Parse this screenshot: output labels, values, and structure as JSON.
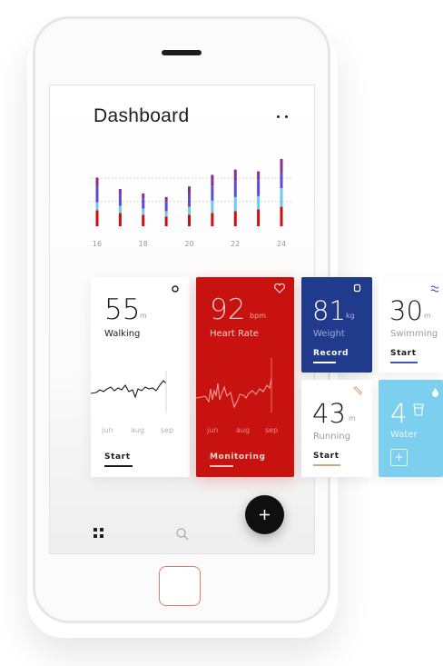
{
  "screen": {
    "title": "Dashboard",
    "menu_icon": "more-dots-icon"
  },
  "chart_data": {
    "type": "bar",
    "stacked": true,
    "x": [
      16,
      17,
      18,
      19,
      20,
      21,
      22,
      23,
      24
    ],
    "tick_labels": [
      "16",
      "18",
      "20",
      "22",
      "24"
    ],
    "series": [
      {
        "color": "#c8120f",
        "values": [
          18,
          15,
          13,
          11,
          13,
          15,
          17,
          19,
          22
        ]
      },
      {
        "color": "#6fc6ef",
        "values": [
          9,
          8,
          7,
          6,
          9,
          14,
          16,
          15,
          21
        ]
      },
      {
        "color": "#5b4bd6",
        "values": [
          18,
          14,
          11,
          10,
          14,
          17,
          18,
          18,
          18
        ]
      },
      {
        "color": "#8a2f8f",
        "values": [
          10,
          5,
          6,
          6,
          9,
          12,
          13,
          10,
          15
        ]
      }
    ],
    "ylim": [
      0,
      80
    ],
    "grid": true
  },
  "cards": {
    "walking": {
      "value": "55",
      "unit": "m",
      "label": "Walking",
      "action": "Start",
      "months": [
        "jun",
        "aug",
        "sep"
      ],
      "icon": "circle-icon"
    },
    "heart_rate": {
      "value": "92",
      "unit": "bpm",
      "label": "Heart Rate",
      "action": "Monitoring",
      "months": [
        "jun",
        "aug",
        "sep"
      ],
      "icon": "heart-icon"
    },
    "weight": {
      "value": "81",
      "unit": "kg",
      "label": "Weight",
      "action": "Record",
      "icon": "scale-icon"
    },
    "swimming": {
      "value": "30",
      "unit": "m",
      "label": "Swimming",
      "action": "Start",
      "icon": "waves-icon"
    },
    "running": {
      "value": "43",
      "unit": "m",
      "label": "Running",
      "action": "Start",
      "icon": "shoe-icon"
    },
    "water": {
      "value": "4",
      "label": "Water",
      "action": "+",
      "icon": "glass-icon"
    }
  },
  "nav": {
    "items": [
      "grid-icon",
      "search-icon"
    ],
    "fab": "+"
  },
  "colors": {
    "heart": "#c8120f",
    "weight": "#213b8c",
    "water": "#7dcff0",
    "swimming_accent": "#3a55c4",
    "running_accent": "#e0a17a"
  }
}
